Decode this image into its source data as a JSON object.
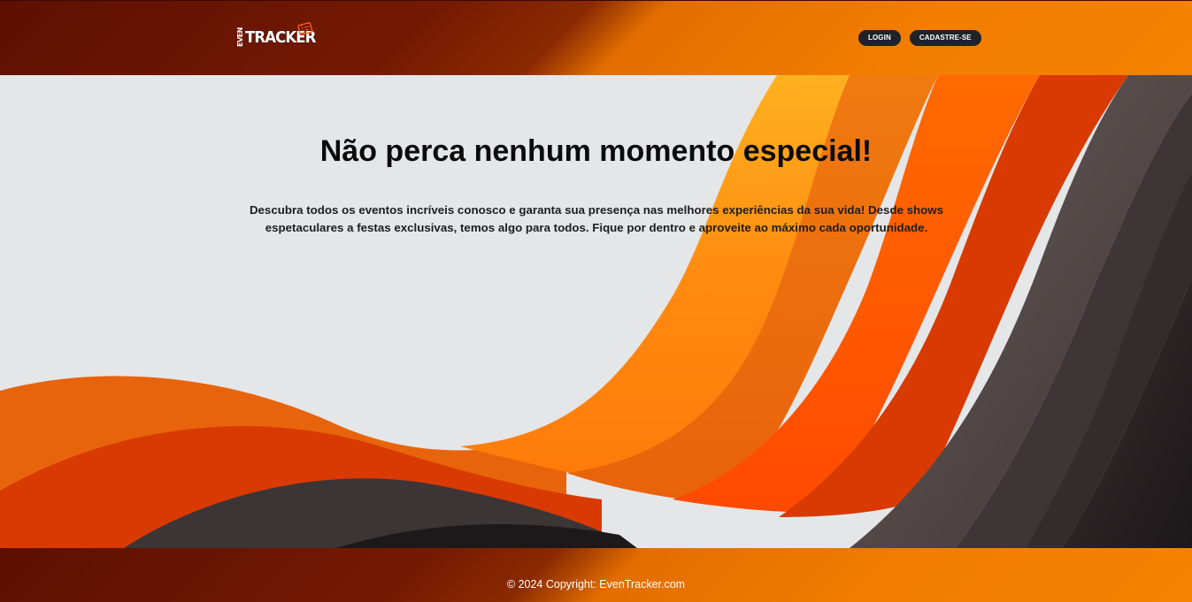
{
  "header": {
    "logo_small": "EVEN",
    "logo_main": "TRACKER",
    "nav": [
      {
        "label": "LOGIN"
      },
      {
        "label": "CADASTRE-SE"
      }
    ]
  },
  "hero": {
    "title": "Não perca nenhum momento especial!",
    "text": "Descubra todos os eventos incríveis conosco e garanta sua presença nas melhores experiências da sua vida! Desde shows espetaculares a festas exclusivas, temos algo para todos. Fique por dentro e aproveite ao máximo cada oportunidade."
  },
  "footer": {
    "copyright": "© 2024 Copyright: EvenTracker.com"
  },
  "colors": {
    "accent": "#f27d00",
    "dark_red": "#5e0f02",
    "button_bg": "#1f2328",
    "background": "#e5e6e8"
  },
  "icons": [
    "ticket-icon"
  ]
}
